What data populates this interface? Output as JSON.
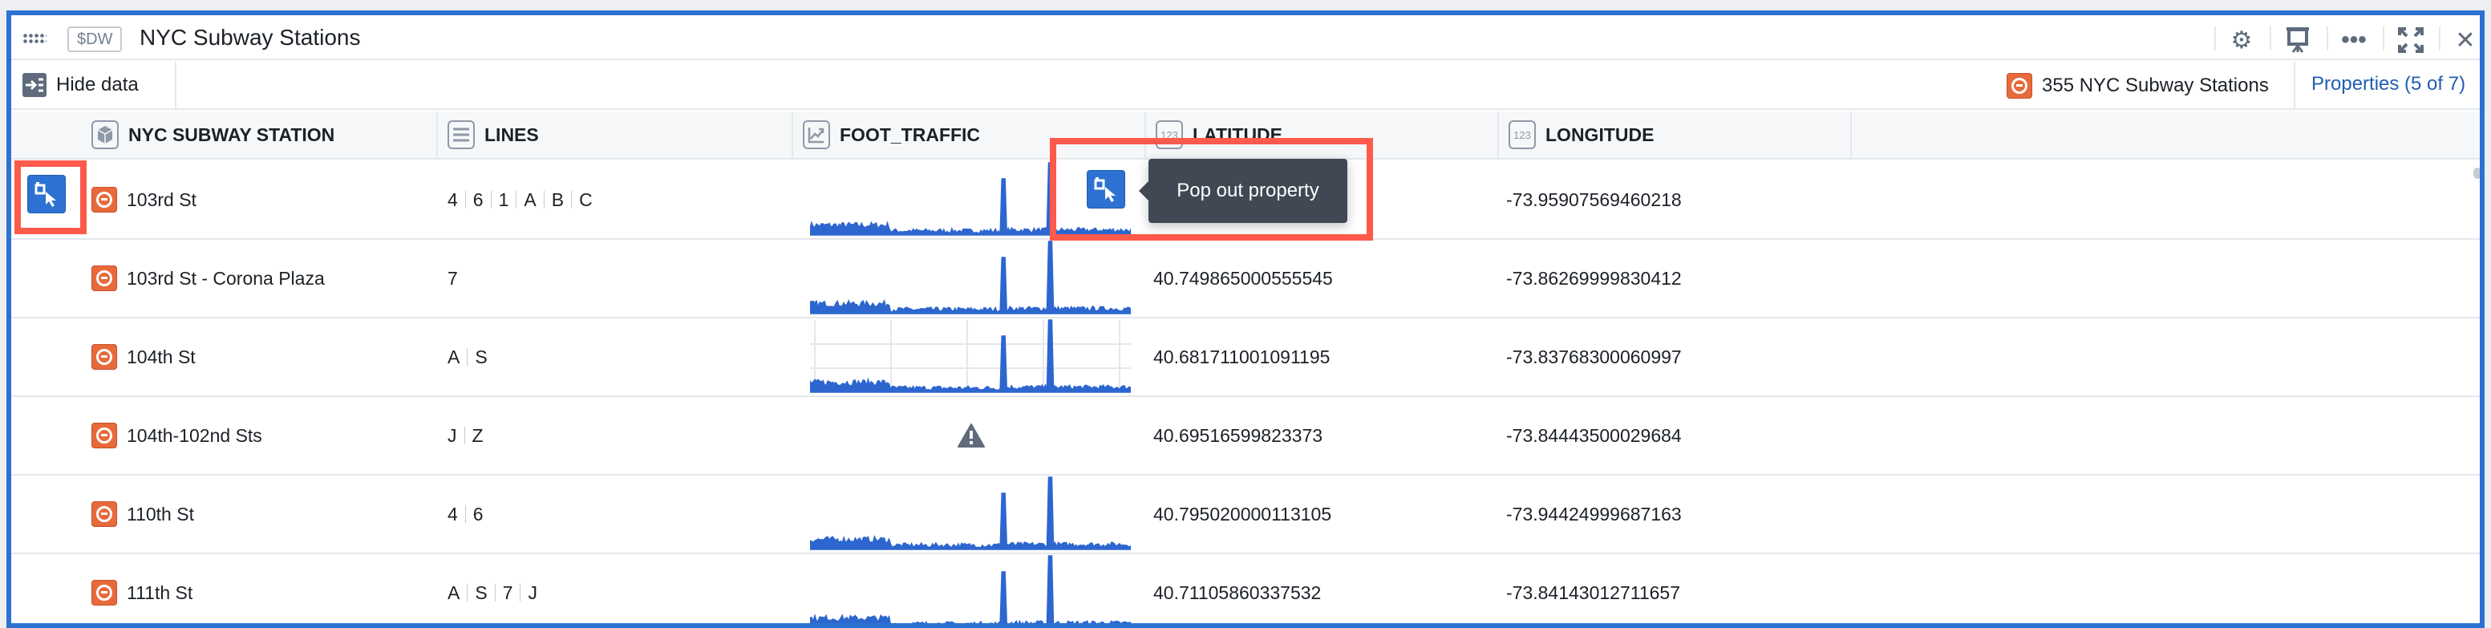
{
  "header": {
    "tag": "$DW",
    "title": "NYC Subway Stations",
    "icons": [
      "gear-icon",
      "presentation-icon",
      "more-icon",
      "expand-icon",
      "close-icon"
    ]
  },
  "toolbar": {
    "hide_data": "Hide data",
    "count": "355 NYC Subway Stations",
    "properties": "Properties (5 of 7)"
  },
  "columns": [
    {
      "label": "NYC SUBWAY STATION",
      "icon": "cube-icon"
    },
    {
      "label": "LINES",
      "icon": "list-icon"
    },
    {
      "label": "FOOT_TRAFFIC",
      "icon": "timeseries-icon"
    },
    {
      "label": "LATITUDE",
      "icon": "123"
    },
    {
      "label": "LONGITUDE",
      "icon": "123"
    }
  ],
  "rows": [
    {
      "station": "103rd St",
      "lines": [
        "4",
        "6",
        "1",
        "A",
        "B",
        "C"
      ],
      "foot_traffic": "sparkline",
      "latitude": "",
      "longitude": "-73.95907569460218"
    },
    {
      "station": "103rd St - Corona Plaza",
      "lines": [
        "7"
      ],
      "foot_traffic": "sparkline",
      "latitude": "40.749865000555545",
      "longitude": "-73.86269999830412"
    },
    {
      "station": "104th St",
      "lines": [
        "A",
        "S"
      ],
      "foot_traffic": "sparkline",
      "latitude": "40.681711001091195",
      "longitude": "-73.83768300060997"
    },
    {
      "station": "104th-102nd Sts",
      "lines": [
        "J",
        "Z"
      ],
      "foot_traffic": "warning",
      "latitude": "40.69516599823373",
      "longitude": "-73.84443500029684"
    },
    {
      "station": "110th St",
      "lines": [
        "4",
        "6"
      ],
      "foot_traffic": "sparkline",
      "latitude": "40.795020000113105",
      "longitude": "-73.94424999687163"
    },
    {
      "station": "111th St",
      "lines": [
        "A",
        "S",
        "7",
        "J"
      ],
      "foot_traffic": "sparkline",
      "latitude": "40.71105860337532",
      "longitude": "-73.84143012711657"
    }
  ],
  "tooltip": {
    "text": "Pop out property"
  },
  "colors": {
    "accent": "#2d72d2",
    "object_icon": "#e76a3b",
    "annotation": "#fd5a4b",
    "sparkline": "#2d66cf"
  }
}
